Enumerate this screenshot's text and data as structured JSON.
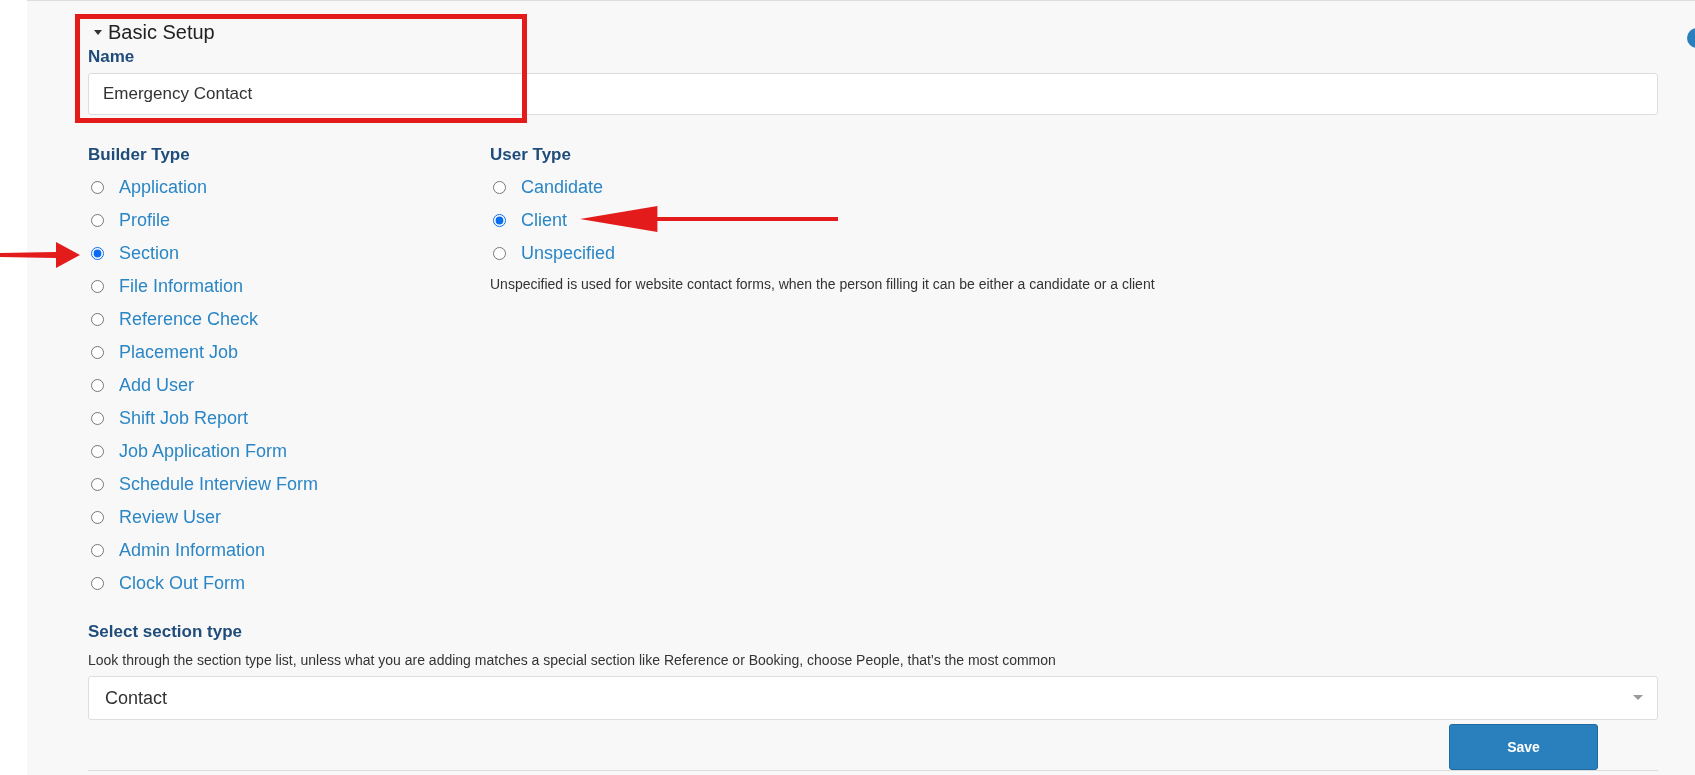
{
  "section": {
    "title": "Basic Setup",
    "expanded": true
  },
  "name_field": {
    "label": "Name",
    "value": "Emergency Contact"
  },
  "builder_type": {
    "label": "Builder Type",
    "options": [
      {
        "label": "Application",
        "selected": false
      },
      {
        "label": "Profile",
        "selected": false
      },
      {
        "label": "Section",
        "selected": true
      },
      {
        "label": "File Information",
        "selected": false
      },
      {
        "label": "Reference Check",
        "selected": false
      },
      {
        "label": "Placement Job",
        "selected": false
      },
      {
        "label": "Add User",
        "selected": false
      },
      {
        "label": "Shift Job Report",
        "selected": false
      },
      {
        "label": "Job Application Form",
        "selected": false
      },
      {
        "label": "Schedule Interview Form",
        "selected": false
      },
      {
        "label": "Review User",
        "selected": false
      },
      {
        "label": "Admin Information",
        "selected": false
      },
      {
        "label": "Clock Out Form",
        "selected": false
      }
    ]
  },
  "user_type": {
    "label": "User Type",
    "options": [
      {
        "label": "Candidate",
        "selected": false
      },
      {
        "label": "Client",
        "selected": true
      },
      {
        "label": "Unspecified",
        "selected": false
      }
    ],
    "help": "Unspecified is used for website contact forms, when the person filling it can be either a candidate or a client"
  },
  "section_type": {
    "label": "Select section type",
    "help": "Look through the section type list, unless what you are adding matches a special section like Reference or Booking, choose People, that’s the most common",
    "value": "Contact"
  },
  "buttons": [
    "Save"
  ]
}
